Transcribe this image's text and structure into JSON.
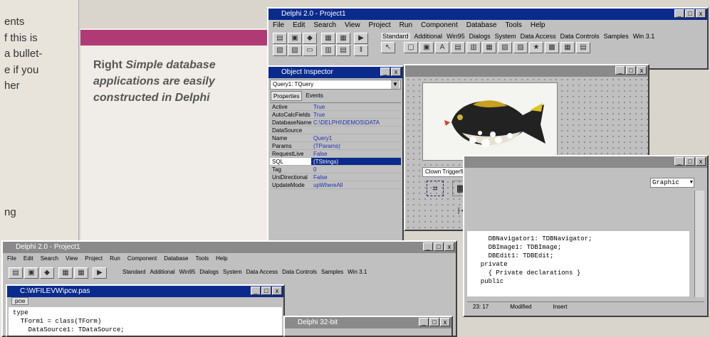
{
  "article": {
    "text_lines": [
      "ents",
      "f this is",
      "a bullet-",
      "e if you",
      "her",
      "ng"
    ],
    "caption_lead": "Right",
    "caption_body": "Simple database applications are easily constructed in Delphi"
  },
  "main_window": {
    "title": "Delphi 2.0 - Project1",
    "menu": [
      "File",
      "Edit",
      "Search",
      "View",
      "Project",
      "Run",
      "Component",
      "Database",
      "Tools",
      "Help"
    ],
    "palette_tabs": [
      "Standard",
      "Additional",
      "Win95",
      "Dialogs",
      "System",
      "Data Access",
      "Data Controls",
      "Samples",
      "Win 3.1"
    ]
  },
  "object_inspector": {
    "title": "Object Inspector",
    "selected_component": "Query1: TQuery",
    "tabs": [
      "Properties",
      "Events"
    ],
    "properties": [
      {
        "name": "Active",
        "value": "True"
      },
      {
        "name": "AutoCalcFields",
        "value": "True"
      },
      {
        "name": "DatabaseName",
        "value": "C:\\DELPHI\\DEMOS\\DATA"
      },
      {
        "name": "DataSource",
        "value": ""
      },
      {
        "name": "Name",
        "value": "Query1"
      },
      {
        "name": "Params",
        "value": "(TParams)"
      },
      {
        "name": "RequestLive",
        "value": "False"
      },
      {
        "name": "SQL",
        "value": "(TStrings)"
      },
      {
        "name": "Tag",
        "value": "0"
      },
      {
        "name": "UniDirectional",
        "value": "False"
      },
      {
        "name": "UpdateMode",
        "value": "upWhereAll"
      }
    ]
  },
  "form_window": {
    "edit_value": "Clown Triggerfish",
    "nav_buttons": [
      "|◄",
      "◄",
      "►",
      "►|",
      "+",
      "−",
      "▲",
      "✓",
      "✕",
      "↻"
    ]
  },
  "code_window": {
    "dropdown": "Graphic",
    "lines": [
      {
        "text": "    DBNavigator1: TDBNavigator;",
        "style": "plain"
      },
      {
        "text": "    DBImage1: TDBImage;",
        "style": "plain"
      },
      {
        "text": "    DBEdit1: TDBEdit;",
        "style": "plain"
      },
      {
        "text": "  private",
        "style": "kw"
      },
      {
        "text": "    { Private declarations }",
        "style": "cm"
      },
      {
        "text": "  public",
        "style": "kw"
      }
    ],
    "status_pos": "23: 17",
    "status_mod": "Modified",
    "status_ins": "Insert"
  },
  "second_ide": {
    "title": "Delphi 2.0 - Project1",
    "menu": [
      "File",
      "Edit",
      "Search",
      "View",
      "Project",
      "Run",
      "Component",
      "Database",
      "Tools",
      "Help"
    ],
    "palette_tabs": [
      "Standard",
      "Additional",
      "Win95",
      "Dialogs",
      "System",
      "Data Access",
      "Data Controls",
      "Samples",
      "Win 3.1"
    ],
    "unit_title": "C:\\WFILEVW\\pcw.pas",
    "unit_tab": "pcw",
    "code": [
      {
        "text": "type",
        "style": "kw"
      },
      {
        "text": "  TForm1 = class(TForm)",
        "style": "plain"
      },
      {
        "text": "    DataSource1: TDataSource;",
        "style": "plain"
      }
    ],
    "small_title": "Delphi 32-bit"
  }
}
